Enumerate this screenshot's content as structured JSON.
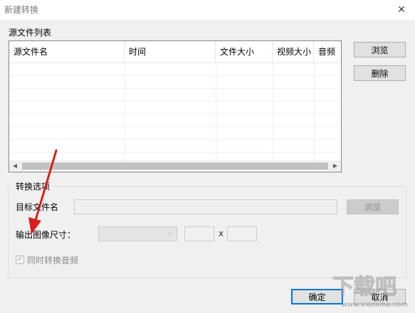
{
  "window": {
    "title": "新建转换",
    "close_glyph": "✕"
  },
  "source": {
    "label": "源文件列表",
    "columns": [
      "源文件名",
      "时间",
      "文件大小",
      "视频大小",
      "音频"
    ],
    "browse_label": "浏览",
    "delete_label": "删除"
  },
  "options": {
    "group_title": "转换选项",
    "target_label": "目标文件名",
    "target_value": "",
    "target_browse_label": "浏览",
    "size_label": "输出图像尺寸：",
    "size_selected": "",
    "width_value": "",
    "by_label": "x",
    "height_value": "",
    "audio_label": "同时转换音频",
    "audio_checked": true
  },
  "footer": {
    "ok_label": "确定",
    "cancel_label": "取消"
  },
  "watermark": {
    "text": "下载吧",
    "url": "www.xiazaiba.com"
  },
  "colors": {
    "annotation_arrow": "#d9201c",
    "focus_border": "#0078d7"
  }
}
